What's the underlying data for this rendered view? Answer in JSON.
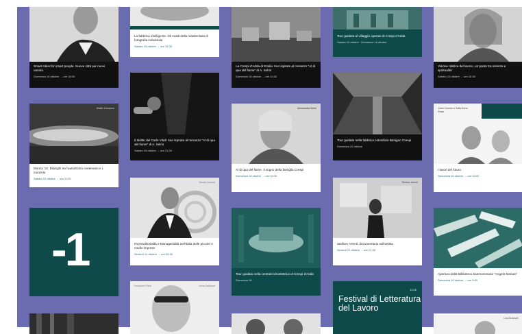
{
  "colors": {
    "band": "#6b6bb0",
    "teal": "#0f4a4a",
    "dark": "#111111",
    "meta": "#1b6f6f"
  },
  "columns": [
    {
      "cards": [
        {
          "title": "Smart cities for smart people. Nuove città per nuovi uomini.",
          "meta": "Domenica 16 ottobre → ore 16:00"
        },
        {
          "tag": "Walter Consonni",
          "title": "Monza '22. Dialoghi tra l'autodromo centenario e i monzesi",
          "meta": "Sabato 15 ottobre → ore 11:00"
        },
        {
          "big": "-1"
        },
        {}
      ]
    },
    {
      "cards": [
        {
          "title": "La fabbrica intelligente. Gli scatti della masterclass di fotografia industriale",
          "meta": "Sabato 15 ottobre → ore 15:30"
        },
        {
          "title": "Il delitto del Carlo Vitali: tour ispirato al romanzo “Al di qua del fiume” di A. Selmi",
          "meta": "Sabato 15 ottobre → ore 21:00"
        },
        {
          "tag": "Sandro Danesi",
          "title": "Imprenditorialità e Managerialità nell'Italia delle piccole e medie imprese",
          "meta": "Venerdì 14 ottobre → ore 09:30"
        },
        {
          "tag": "Fernando Pizzo",
          "tag2": "Anna Gallaone"
        }
      ]
    },
    {
      "cards": [
        {
          "title": "La Crespi d'Adda di Emilia: tour ispirato al romanzo “Al di qua del fiume” di A. Selmi",
          "meta": "Domenica 16 ottobre → ore 10:30"
        },
        {
          "tag": "Alessandra Selmi",
          "title": "Al di qua del fiume. Il sogno della famiglia Crespi",
          "meta": "Domenica 16 ottobre → ore 11:00"
        },
        {
          "title": "Tour guidato nella centrale idroelettrica di Crespi d'Adda",
          "meta": "Domenica 16"
        },
        {}
      ]
    },
    {
      "cards": [
        {
          "title": "Tour guidato al villaggio operaio di Crespi d'Adda",
          "meta": "Sabato 15 ottobre · Domenica 16 ottobre"
        },
        {
          "title": "Tour guidato nella fabbrica cotonificio Benigno Crespi",
          "meta": "Domenica 22 ottobre"
        },
        {
          "tag": "Stefano Arienti",
          "title": "Stefano Arienti: documentario sull'artista",
          "meta": "Venerdì 21 ottobre → ore 21:00"
        },
        {
          "festival": "Festival di Letteratura del Lavoro",
          "year": "11:00"
        }
      ]
    },
    {
      "cards": [
        {
          "title": "Visione olistica del lavoro, un ponte tra scienza e spiritualità",
          "meta": "Sabato 15 ottobre → ore 15:30"
        },
        {
          "tag": "Carlo Conese e Sofia Enna Rossi",
          "title": "I lavori del futuro",
          "meta": "Domenica 16 ottobre → ore 16:00"
        },
        {
          "title": "Apertura della Biblioteca Sanmommaria \"Angelo Mariani\"",
          "meta": "Domenica 16 ottobre → ore 9:00"
        },
        {
          "tag": "Lisa Brazzale"
        }
      ]
    }
  ]
}
